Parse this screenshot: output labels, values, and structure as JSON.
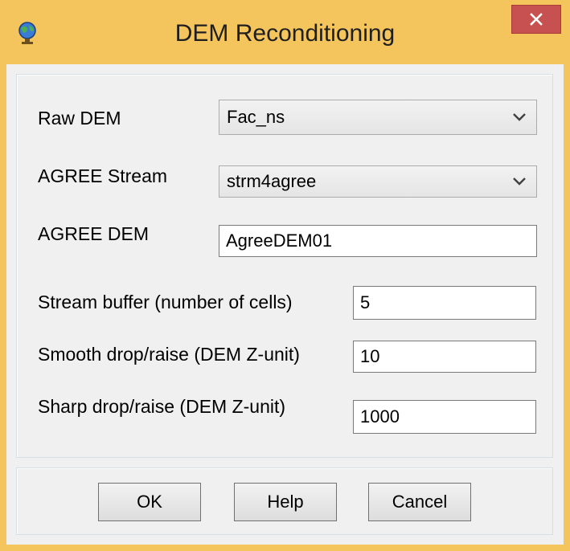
{
  "window": {
    "title": "DEM Reconditioning",
    "close_icon": "close-icon",
    "app_icon": "globe-icon"
  },
  "fields": {
    "raw_dem": {
      "label": "Raw DEM",
      "value": "Fac_ns"
    },
    "agree_stream": {
      "label": "AGREE Stream",
      "value": "strm4agree"
    },
    "agree_dem": {
      "label": "AGREE DEM",
      "value": "AgreeDEM01"
    },
    "stream_buffer": {
      "label": "Stream buffer (number of cells)",
      "value": "5"
    },
    "smooth_drop": {
      "label": "Smooth drop/raise (DEM Z-unit)",
      "value": "10"
    },
    "sharp_drop": {
      "label": "Sharp drop/raise (DEM Z-unit)",
      "value": "1000"
    }
  },
  "buttons": {
    "ok": "OK",
    "help": "Help",
    "cancel": "Cancel"
  },
  "colors": {
    "titlebar": "#f5c55d",
    "close_button": "#c75050",
    "client": "#f0f0f0"
  }
}
